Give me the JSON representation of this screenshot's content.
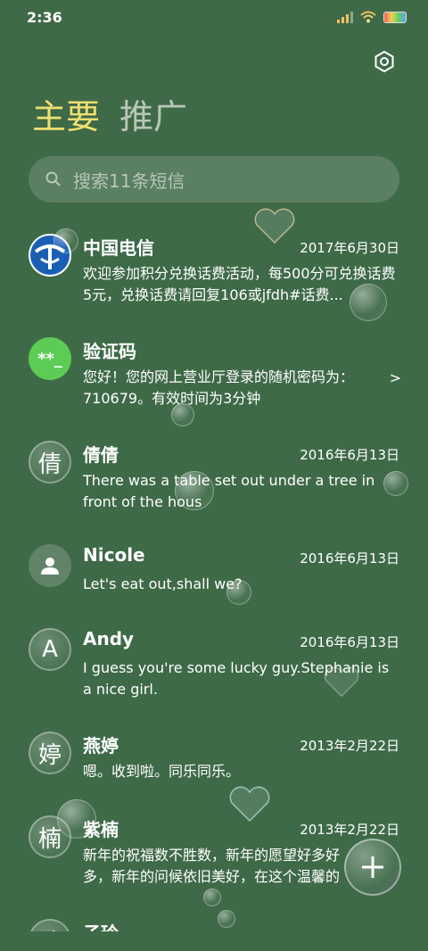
{
  "status_bar": {
    "time": "2:36"
  },
  "tabs": [
    {
      "label": "主要",
      "active": true
    },
    {
      "label": "推广",
      "active": false
    }
  ],
  "search": {
    "placeholder": "搜索11条短信"
  },
  "conversations": [
    {
      "name": "中国电信",
      "date": "2017年6月30日",
      "preview": "欢迎参加积分兑换话费活动，每500分可兑换话费5元，兑换话费请回复106或jfdh#话费...",
      "avatar_type": "telecom-logo-icon",
      "avatar_text": ""
    },
    {
      "name": "验证码",
      "date": "",
      "preview": "您好！您的网上营业厅登录的随机密码为：710679。有效时间为3分钟",
      "avatar_type": "code-icon",
      "avatar_text": "**_",
      "chevron": ">"
    },
    {
      "name": "倩倩",
      "date": "2016年6月13日",
      "preview": "There was a table set out under a tree in front of the hous",
      "avatar_type": "letter",
      "avatar_text": "倩"
    },
    {
      "name": "Nicole",
      "date": "2016年6月13日",
      "preview": "Let's eat out,shall we?",
      "avatar_type": "person-icon",
      "avatar_text": ""
    },
    {
      "name": "Andy",
      "date": "2016年6月13日",
      "preview": "I guess you're some lucky guy.Stephanie is a nice girl.",
      "avatar_type": "letter",
      "avatar_text": "A"
    },
    {
      "name": "燕婷",
      "date": "2013年2月22日",
      "preview": "嗯。收到啦。同乐同乐。",
      "avatar_type": "letter",
      "avatar_text": "婷"
    },
    {
      "name": "紫楠",
      "date": "2013年2月22日",
      "preview": "新年的祝福数不胜数，新年的愿望好多好多，新年的问候依旧美好，在这个温馨的时刻",
      "avatar_type": "letter",
      "avatar_text": "楠"
    },
    {
      "name": "子玲",
      "date": "",
      "preview": "",
      "avatar_type": "letter",
      "avatar_text": "玲"
    }
  ],
  "fab": {
    "icon": "plus-icon",
    "label": "+"
  }
}
